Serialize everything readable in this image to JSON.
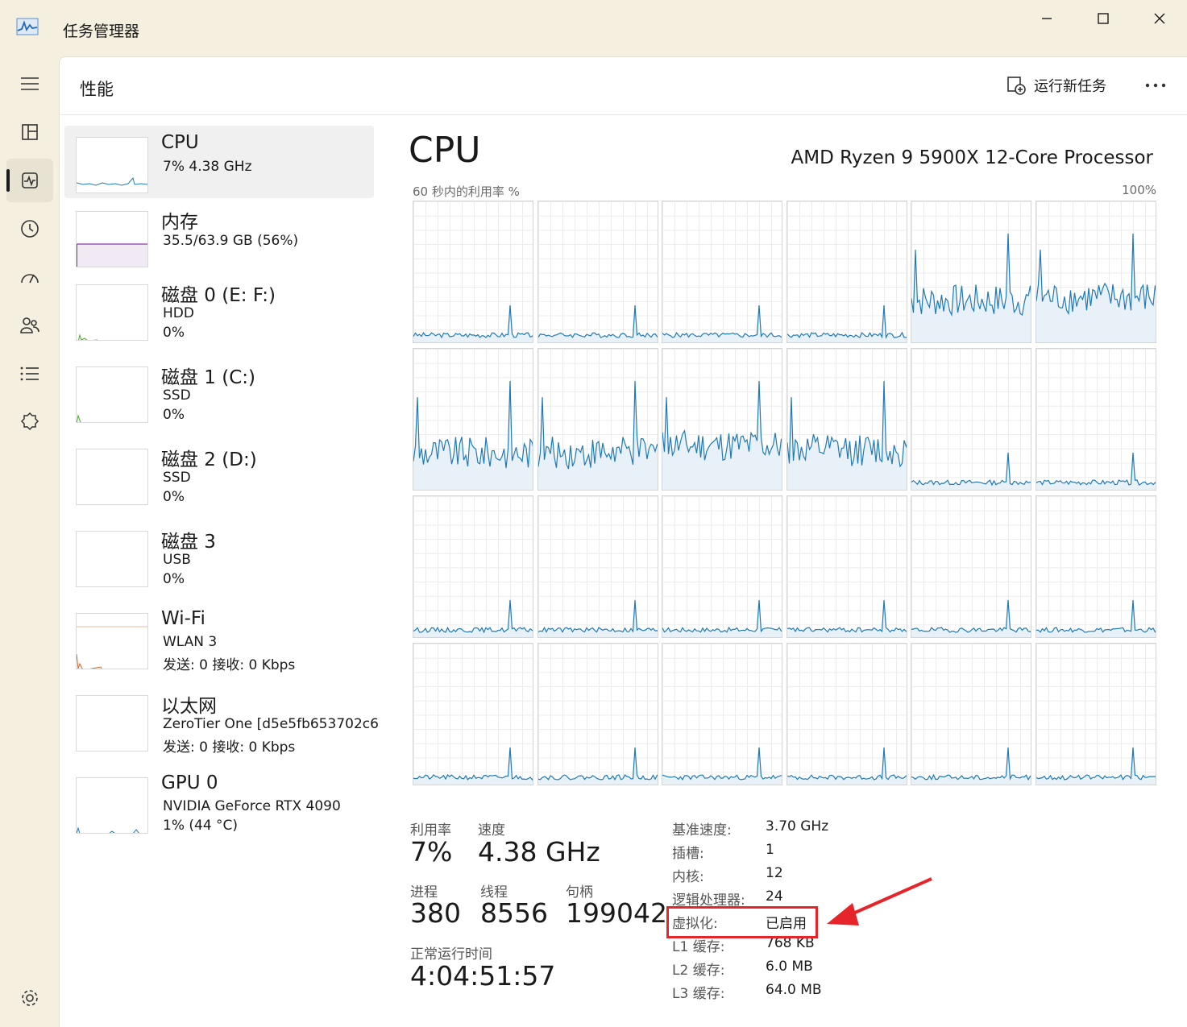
{
  "window": {
    "title": "任务管理器",
    "icon": "activity-chart-icon"
  },
  "header": {
    "page_title": "性能",
    "run_task_label": "运行新任务"
  },
  "nav": [
    {
      "icon": "hamburger-menu-icon"
    },
    {
      "icon": "processes-icon"
    },
    {
      "icon": "performance-icon",
      "active": true
    },
    {
      "icon": "app-history-icon"
    },
    {
      "icon": "startup-apps-icon"
    },
    {
      "icon": "users-icon"
    },
    {
      "icon": "details-icon"
    },
    {
      "icon": "services-icon"
    }
  ],
  "devices": [
    {
      "name": "CPU",
      "line1": "7%  4.38 GHz",
      "selected": true
    },
    {
      "name": "内存",
      "line1": "35.5/63.9 GB (56%)"
    },
    {
      "name": "磁盘 0 (E: F:)",
      "line1": "HDD",
      "line2": "0%"
    },
    {
      "name": "磁盘 1 (C:)",
      "line1": "SSD",
      "line2": "0%"
    },
    {
      "name": "磁盘 2 (D:)",
      "line1": "SSD",
      "line2": "0%"
    },
    {
      "name": "磁盘 3",
      "line1": "USB",
      "line2": "0%"
    },
    {
      "name": "Wi-Fi",
      "line1": "WLAN 3",
      "line2": "发送: 0 接收: 0 Kbps"
    },
    {
      "name": "以太网",
      "line1": "ZeroTier One [d5e5fb653702c6",
      "line2": "发送: 0 接收: 0 Kbps"
    },
    {
      "name": "GPU 0",
      "line1": "NVIDIA GeForce RTX 4090",
      "line2": "1%  (44 °C)"
    }
  ],
  "cpu": {
    "title": "CPU",
    "model": "AMD Ryzen 9 5900X 12-Core Processor",
    "graph_label": "60 秒内的利用率 %",
    "graph_max": "100%",
    "core_count_graphs": 24,
    "line_color": "#1f7ab8",
    "fill_color": "#e8f1f8"
  },
  "stats": {
    "utilization_label": "利用率",
    "utilization": "7%",
    "speed_label": "速度",
    "speed": "4.38 GHz",
    "processes_label": "进程",
    "processes": "380",
    "threads_label": "线程",
    "threads": "8556",
    "handles_label": "句柄",
    "handles": "199042",
    "uptime_label": "正常运行时间",
    "uptime": "4:04:51:57"
  },
  "specs": [
    {
      "key": "基准速度:",
      "value": "3.70 GHz"
    },
    {
      "key": "插槽:",
      "value": "1"
    },
    {
      "key": "内核:",
      "value": "12"
    },
    {
      "key": "逻辑处理器:",
      "value": "24"
    },
    {
      "key": "虚拟化:",
      "value": "已启用"
    },
    {
      "key": "L1 缓存:",
      "value": "768 KB"
    },
    {
      "key": "L2 缓存:",
      "value": "6.0 MB"
    },
    {
      "key": "L3 缓存:",
      "value": "64.0 MB"
    }
  ],
  "annotation": {
    "highlight_color": "#e5252a"
  }
}
